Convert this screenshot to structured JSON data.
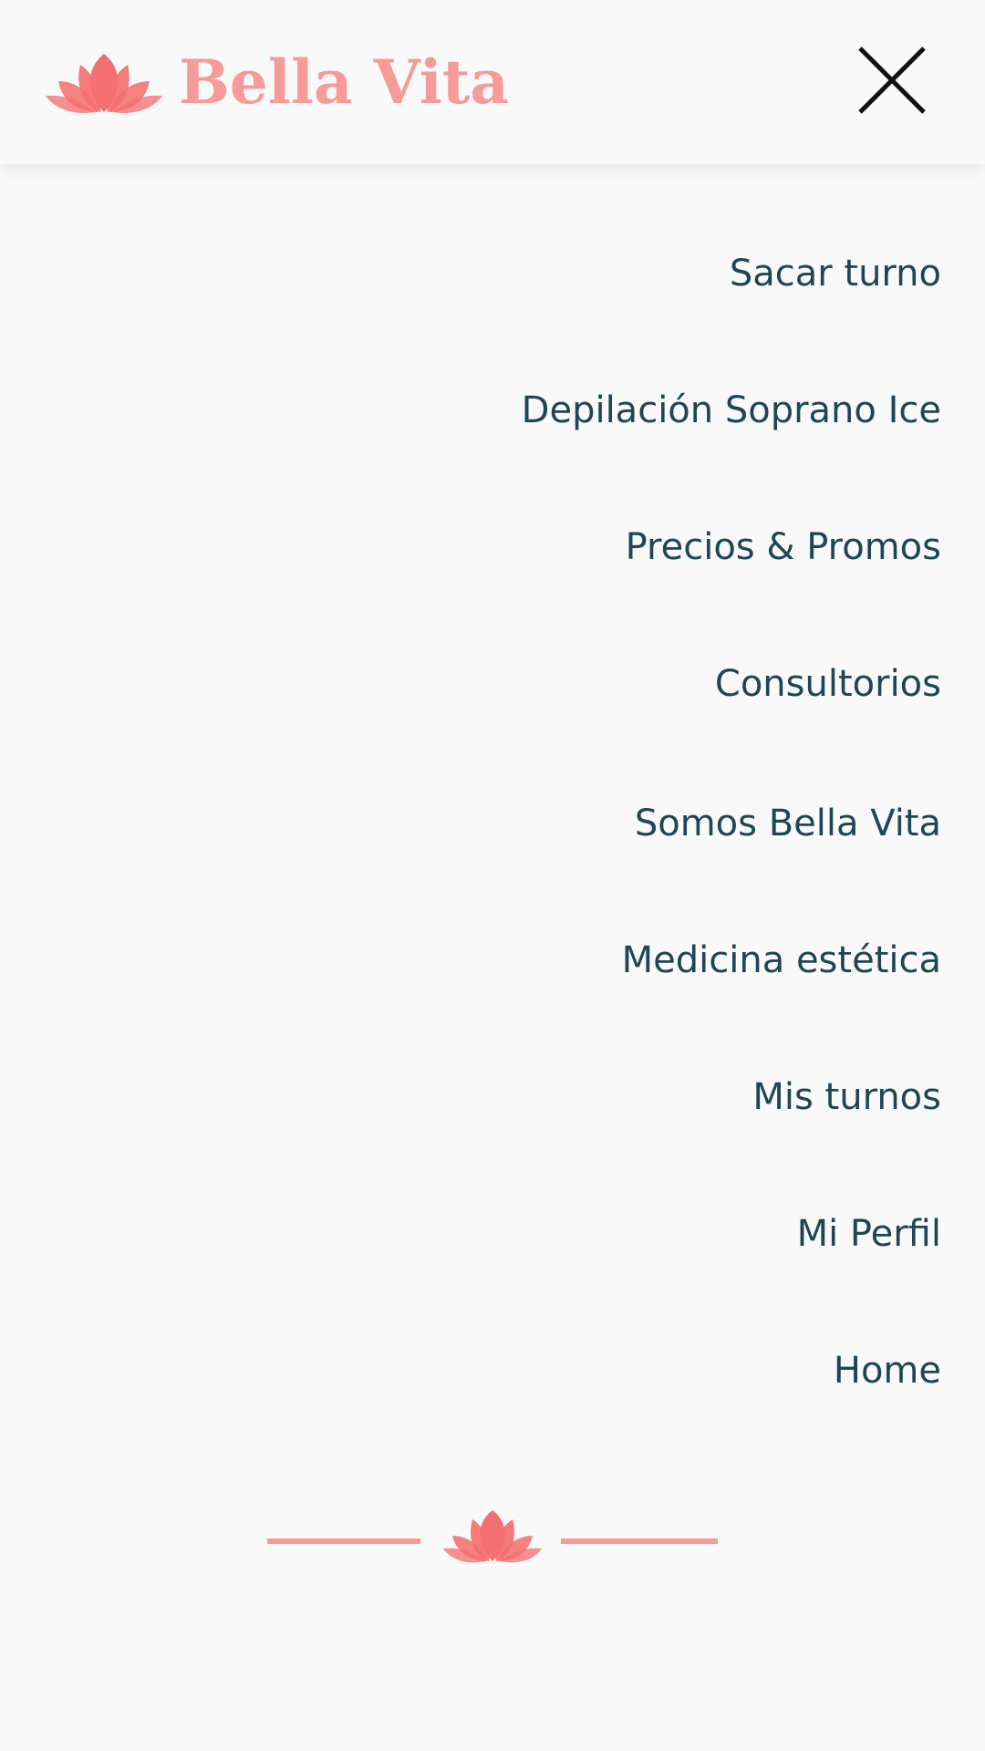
{
  "brand": {
    "name": "Bella Vita",
    "logo_icon": "lotus-icon"
  },
  "header": {
    "close_icon": "close-icon"
  },
  "menu": {
    "items": [
      {
        "label": "Sacar turno"
      },
      {
        "label": "Depilación Soprano Ice"
      },
      {
        "label": "Precios & Promos"
      },
      {
        "label": "Consultorios"
      },
      {
        "label": "Somos Bella Vita"
      },
      {
        "label": "Medicina estética"
      },
      {
        "label": "Mis turnos"
      },
      {
        "label": "Mi Perfil"
      },
      {
        "label": "Home"
      }
    ]
  },
  "footer": {
    "divider_icon": "lotus-icon"
  },
  "colors": {
    "background": "#f9f9f9",
    "brand": "#f79a9a",
    "lotus": "#f46f6f",
    "menu_text": "#1f4656",
    "close_icon": "#111111"
  }
}
